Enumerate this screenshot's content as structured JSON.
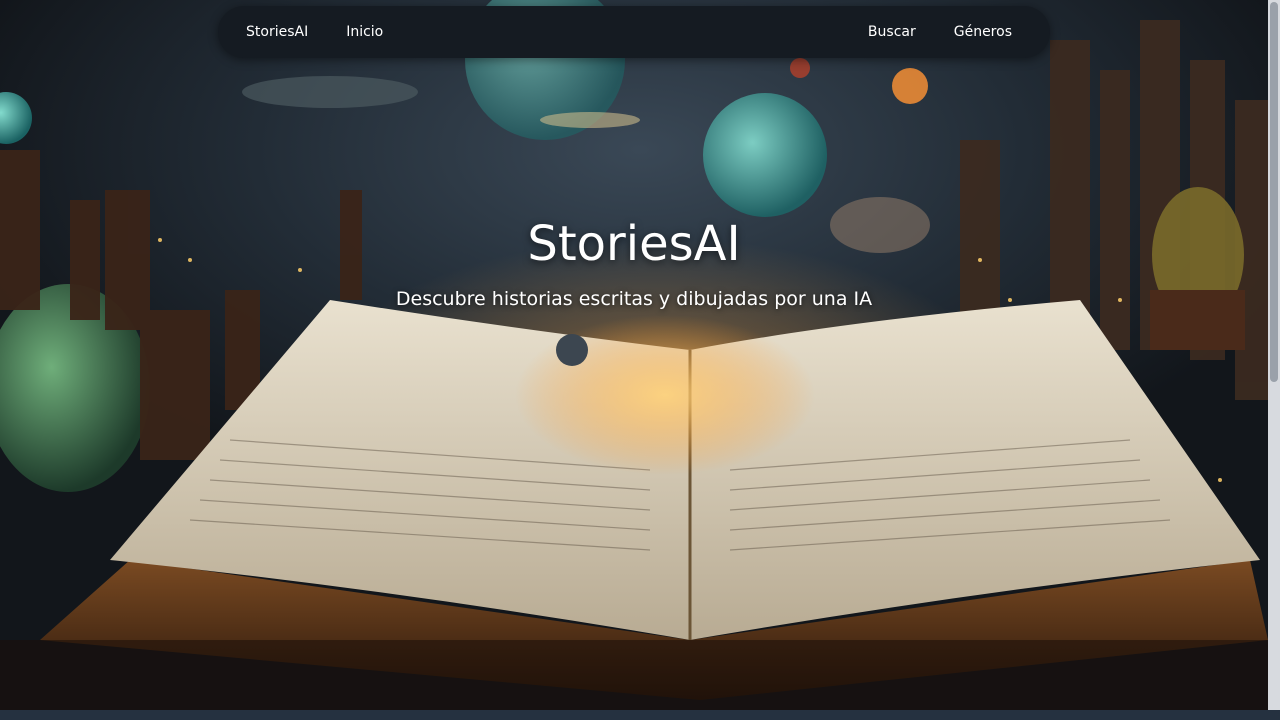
{
  "navbar": {
    "brand": "StoriesAI",
    "left_links": [
      "Inicio"
    ],
    "right_links": [
      "Buscar",
      "Géneros"
    ]
  },
  "hero": {
    "title": "StoriesAI",
    "subtitle": "Descubre historias escritas y dibujadas por una IA",
    "background_image": "open-book-fantasy-city-illustration"
  },
  "colors": {
    "navbar_bg": "#151b22",
    "text": "#ffffff",
    "page_bg": "#1e2732"
  }
}
